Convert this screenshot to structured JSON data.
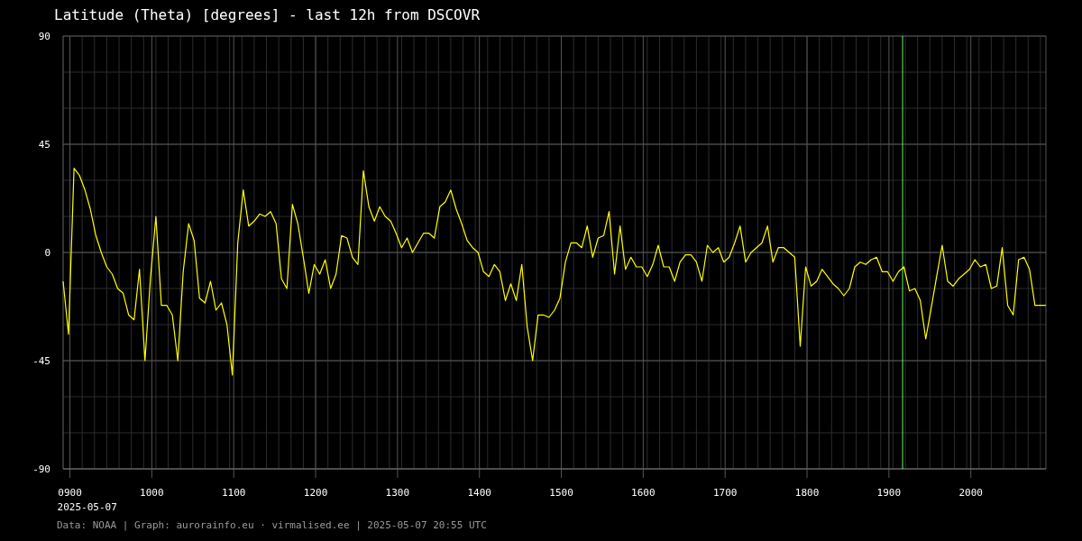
{
  "title": "Latitude (Theta) [degrees] - last 12h from DSCOVR",
  "chart": {
    "chart_data": {
      "type": "line",
      "xlim": [
        891.7,
        2091.7
      ],
      "ylim": [
        -90,
        90
      ],
      "xticks": [
        {
          "value": 900,
          "label": "0900"
        },
        1000,
        1100,
        1200,
        1300,
        1400,
        1500,
        1600,
        1700,
        1800,
        1900,
        2000
      ],
      "yticks": [
        90,
        45,
        0,
        -45,
        -90
      ],
      "x": [
        891.7,
        898.3,
        905,
        911.7,
        918.3,
        925,
        931.7,
        938.3,
        945,
        951.7,
        958.3,
        965,
        971.7,
        978.3,
        985,
        991.7,
        998.3,
        1005,
        1011.7,
        1018.3,
        1025,
        1031.7,
        1038.3,
        1045,
        1051.7,
        1058.3,
        1065,
        1071.7,
        1078.3,
        1085,
        1091.7,
        1098.3,
        1105,
        1111.7,
        1118.3,
        1125,
        1131.7,
        1138.3,
        1145,
        1151.7,
        1158.3,
        1165,
        1171.7,
        1178.3,
        1185,
        1191.7,
        1198.3,
        1205,
        1211.7,
        1218.3,
        1225,
        1231.7,
        1238.3,
        1245,
        1251.7,
        1258.3,
        1265,
        1271.7,
        1278.3,
        1285,
        1291.7,
        1298.3,
        1305,
        1311.7,
        1318.3,
        1325,
        1331.7,
        1338.3,
        1345,
        1351.7,
        1358.3,
        1365,
        1371.7,
        1378.3,
        1385,
        1391.7,
        1398.3,
        1405,
        1411.7,
        1418.3,
        1425,
        1431.7,
        1438.3,
        1445,
        1451.7,
        1458.3,
        1465,
        1471.7,
        1478.3,
        1485,
        1491.7,
        1498.3,
        1505,
        1511.7,
        1518.3,
        1525,
        1531.7,
        1538.3,
        1545,
        1551.7,
        1558.3,
        1565,
        1571.7,
        1578.3,
        1585,
        1591.7,
        1598.3,
        1605,
        1611.7,
        1618.3,
        1625,
        1631.7,
        1638.3,
        1645,
        1651.7,
        1658.3,
        1665,
        1671.7,
        1678.3,
        1685,
        1691.7,
        1698.3,
        1705,
        1711.7,
        1718.3,
        1725,
        1731.7,
        1738.3,
        1745,
        1751.7,
        1758.3,
        1765,
        1771.7,
        1778.3,
        1785,
        1791.7,
        1798.3,
        1805,
        1811.7,
        1818.3,
        1825,
        1831.7,
        1838.3,
        1845,
        1851.7,
        1858.3,
        1865,
        1871.7,
        1878.3,
        1885,
        1891.7,
        1898.3,
        1905,
        1911.7,
        1918.3,
        1925,
        1931.7,
        1938.3,
        1945,
        1951.7,
        1958.3,
        1965,
        1971.7,
        1978.3,
        1985,
        1991.7,
        1998.3,
        2005,
        2011.7,
        2018.3,
        2025,
        2031.7,
        2038.3,
        2045,
        2051.7,
        2058.3,
        2065,
        2071.7,
        2078.3,
        2085,
        2091.7
      ],
      "series": [
        {
          "color": "#ffff00",
          "values": [
            -12,
            -34,
            35,
            32,
            26,
            18,
            7,
            0,
            -6,
            -9,
            -15,
            -17,
            -26,
            -28,
            -7,
            -45,
            -11,
            15,
            -22,
            -22,
            -26,
            -45,
            -8,
            12,
            5,
            -19,
            -21,
            -12,
            -24,
            -21,
            -30,
            -51,
            4,
            26,
            11,
            13,
            16,
            15,
            17,
            12,
            -11,
            -15,
            20,
            12,
            -2,
            -17,
            -5,
            -9,
            -3,
            -15,
            -9,
            7,
            6,
            -2,
            -5,
            34,
            19,
            13,
            19,
            15,
            13,
            8,
            2,
            6,
            0,
            4,
            8,
            8,
            6,
            19,
            21,
            26,
            18,
            12,
            5,
            2,
            0,
            -8,
            -10,
            -5,
            -8,
            -20,
            -13,
            -20,
            -5,
            -31,
            -45,
            -26,
            -26,
            -27,
            -24,
            -19,
            -4,
            4,
            4,
            2,
            11,
            -2,
            6,
            7,
            17,
            -9,
            11,
            -7,
            -2,
            -6,
            -6,
            -10,
            -5,
            3,
            -6,
            -6,
            -12,
            -4,
            -1,
            -1,
            -4,
            -12,
            3,
            0,
            2,
            -4,
            -2,
            4,
            11,
            -4,
            0,
            2,
            4,
            11,
            -4,
            2,
            2,
            0,
            -2,
            -39,
            -6,
            -14,
            -12,
            -7,
            -10,
            -13,
            -15,
            -18,
            -15,
            -6,
            -4,
            -5,
            -3,
            -2,
            -8,
            -8,
            -12,
            -8,
            -6,
            -16,
            -15,
            -20,
            -36,
            -23,
            -10,
            3,
            -12,
            -14,
            -11,
            -9,
            -7,
            -3,
            -6,
            -5,
            -15,
            -14,
            2,
            -22,
            -26,
            -3,
            -2,
            -7,
            -22,
            -22,
            -22
          ]
        }
      ],
      "grid": true,
      "ref_lines": [
        {
          "axis": "x",
          "value": 1916.7,
          "color": "#66ff66"
        }
      ]
    },
    "date_label": "2025-05-07"
  },
  "footer": "Data: NOAA | Graph: aurorainfo.eu · virmalised.ee | 2025-05-07 20:55 UTC"
}
